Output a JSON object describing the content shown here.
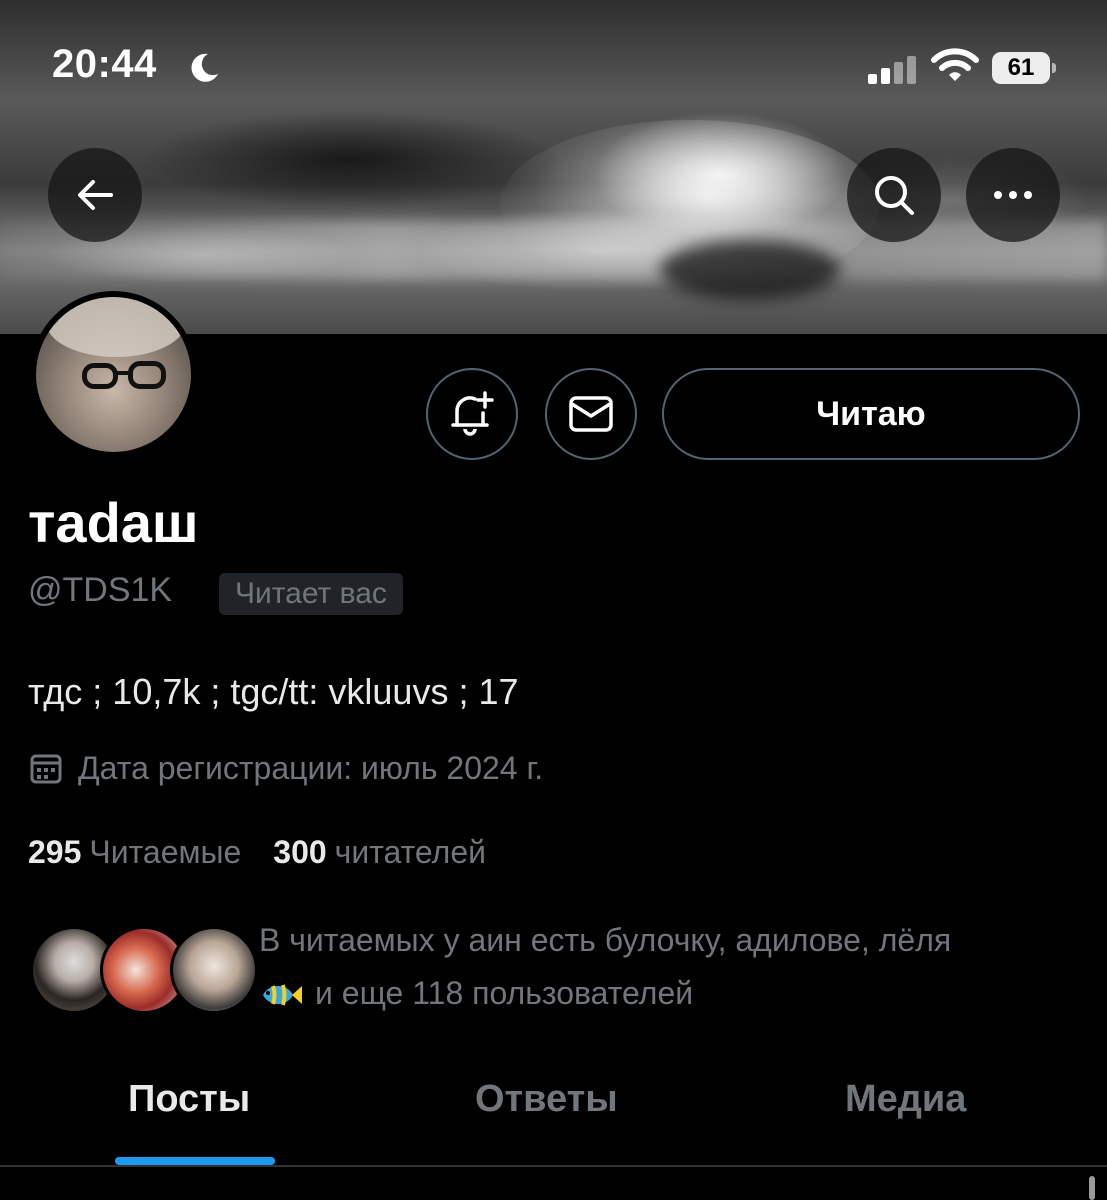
{
  "status_bar": {
    "time": "20:44",
    "battery": "61",
    "icons": [
      "moon-icon",
      "signal-icon",
      "wifi-icon",
      "battery-icon"
    ]
  },
  "header": {
    "icons": [
      "back-arrow-icon",
      "search-icon",
      "more-icon"
    ]
  },
  "profile": {
    "display_name": "тadаш",
    "handle": "@TDS1K",
    "follows_you": "Читает вас",
    "bio": "тдс ; 10,7k ; tgc/tt: vkluuvs ; 17",
    "joined": "Дата регистрации: июль 2024 г.",
    "following_count": "295",
    "following_label": "Читаемые",
    "followers_count": "300",
    "followers_label": "читателей"
  },
  "actions": {
    "follow_label": "Читаю",
    "icons": [
      "bell-plus-icon",
      "mail-icon"
    ]
  },
  "followers_you_know": {
    "line1": "В читаемых у аин есть булочку, адилове, лёля",
    "line2": "и еще 118 пользователей"
  },
  "tabs": [
    {
      "label": "Посты"
    },
    {
      "label": "Ответы"
    },
    {
      "label": "Медиа"
    }
  ],
  "colors": {
    "accent": "#1d9bf0",
    "secondary_text": "#71767b",
    "border": "#536471",
    "background": "#000000"
  }
}
